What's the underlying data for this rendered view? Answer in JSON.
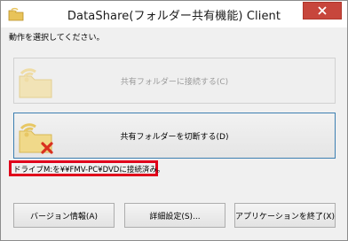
{
  "window": {
    "title": "DataShare(フォルダー共有機能) Client"
  },
  "instruction": "動作を選択してください。",
  "buttons": {
    "connect_label": "共有フォルダーに接続する(C)",
    "disconnect_label": "共有フォルダーを切断する(D)",
    "version_label": "バージョン情報(A)",
    "detail_label": "詳細設定(S)...",
    "exit_label": "アプリケーションを終了(X)"
  },
  "status": {
    "text": "ドライブM:を¥¥FMV-PC¥DVDに接続済み。"
  },
  "colors": {
    "close_button": "#c7463c",
    "status_border": "#e0001b",
    "active_border": "#3c7fb1",
    "disconnect_x": "#d9301f"
  },
  "icons": {
    "app": "folder-share-icon",
    "close": "close-icon",
    "connect": "shared-folder-icon",
    "disconnect": "shared-folder-disconnect-icon"
  }
}
